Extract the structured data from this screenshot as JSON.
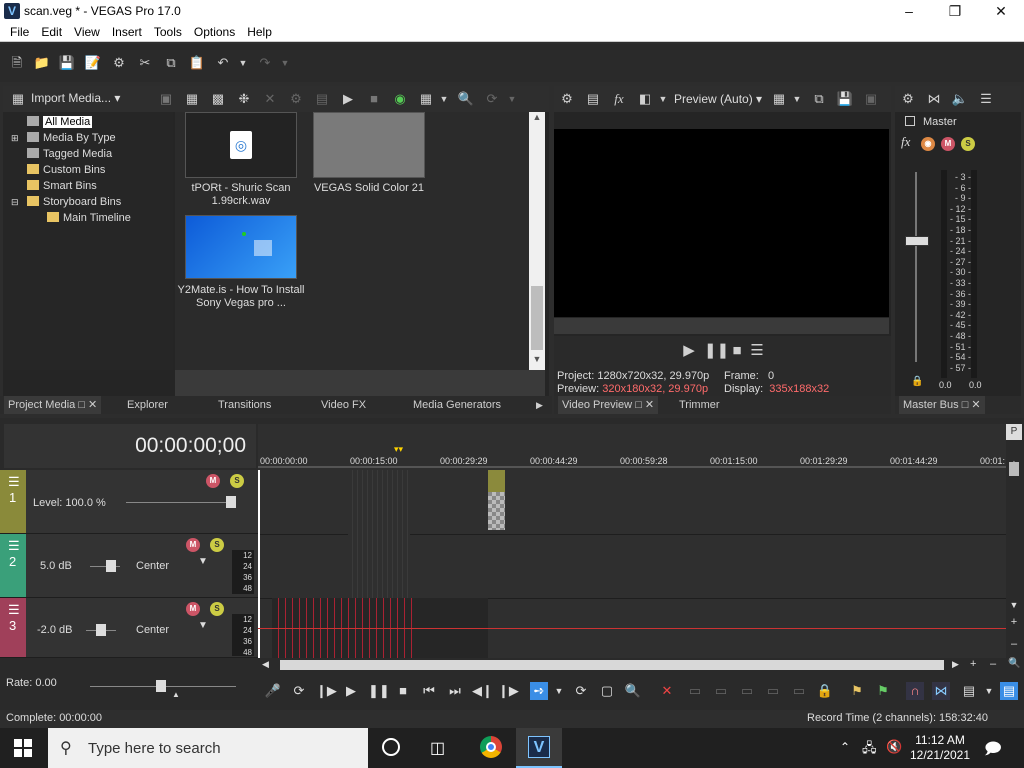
{
  "window": {
    "title": "scan.veg * - VEGAS Pro 17.0",
    "app_icon": "V"
  },
  "menu": [
    "File",
    "Edit",
    "View",
    "Insert",
    "Tools",
    "Options",
    "Help"
  ],
  "media_toolbar": {
    "import_label": "Import Media..."
  },
  "tree": [
    {
      "label": "All Media",
      "selected": true
    },
    {
      "label": "Media By Type"
    },
    {
      "label": "Tagged Media"
    },
    {
      "label": "Custom Bins"
    },
    {
      "label": "Smart Bins"
    },
    {
      "label": "Storyboard Bins"
    },
    {
      "label": "Main Timeline"
    }
  ],
  "media_items": [
    {
      "name": "tPORt - Shuric Scan 1.99crk.wav",
      "kind": "audio"
    },
    {
      "name": "VEGAS Solid Color 21",
      "kind": "solid"
    },
    {
      "name": "Y2Mate.is - How To Install Sony Vegas pro ...",
      "kind": "video"
    }
  ],
  "left_tabs": [
    "Project Media",
    "Explorer",
    "Transitions",
    "Video FX",
    "Media Generators"
  ],
  "preview": {
    "mode_label": "Preview (Auto)",
    "project_label": "Project:",
    "project_value": "1280x720x32, 29.970p",
    "preview_label": "Preview:",
    "preview_value": "320x180x32, 29.970p",
    "frame_label": "Frame:",
    "frame_value": "0",
    "display_label": "Display:",
    "display_value": "335x188x32",
    "tabs": [
      "Video Preview",
      "Trimmer"
    ]
  },
  "master": {
    "label": "Master",
    "tab": "Master Bus",
    "scale": [
      "3",
      "6",
      "9",
      "12",
      "15",
      "18",
      "21",
      "24",
      "27",
      "30",
      "33",
      "36",
      "39",
      "42",
      "45",
      "48",
      "51",
      "54",
      "57"
    ],
    "left_value": "0.0",
    "right_value": "0.0"
  },
  "timeline": {
    "timecode": "00:00:00;00",
    "ruler": [
      "00:00:00:00",
      "00:00:15:00",
      "00:00:29:29",
      "00:00:44:29",
      "00:00:59:28",
      "00:01:15:00",
      "00:01:29:29",
      "00:01:44:29",
      "00:01:"
    ],
    "tracks": [
      {
        "number": "1",
        "level_label": "Level: 100.0 %",
        "color": "#8a8a3a"
      },
      {
        "number": "2",
        "volume": "5.0 dB",
        "pan": "Center",
        "color": "#3aa07a"
      },
      {
        "number": "3",
        "volume": "-2.0 dB",
        "pan": "Center",
        "color": "#a0405a"
      }
    ],
    "db_scale": [
      "12",
      "24",
      "36",
      "48"
    ],
    "rate_label": "Rate: 0.00"
  },
  "status": {
    "complete": "Complete: 00:00:00",
    "record_time": "Record Time (2 channels): 158:32:40"
  },
  "taskbar": {
    "search_placeholder": "Type here to search",
    "time": "11:12 AM",
    "date": "12/21/2021",
    "vegas_letter": "V"
  }
}
